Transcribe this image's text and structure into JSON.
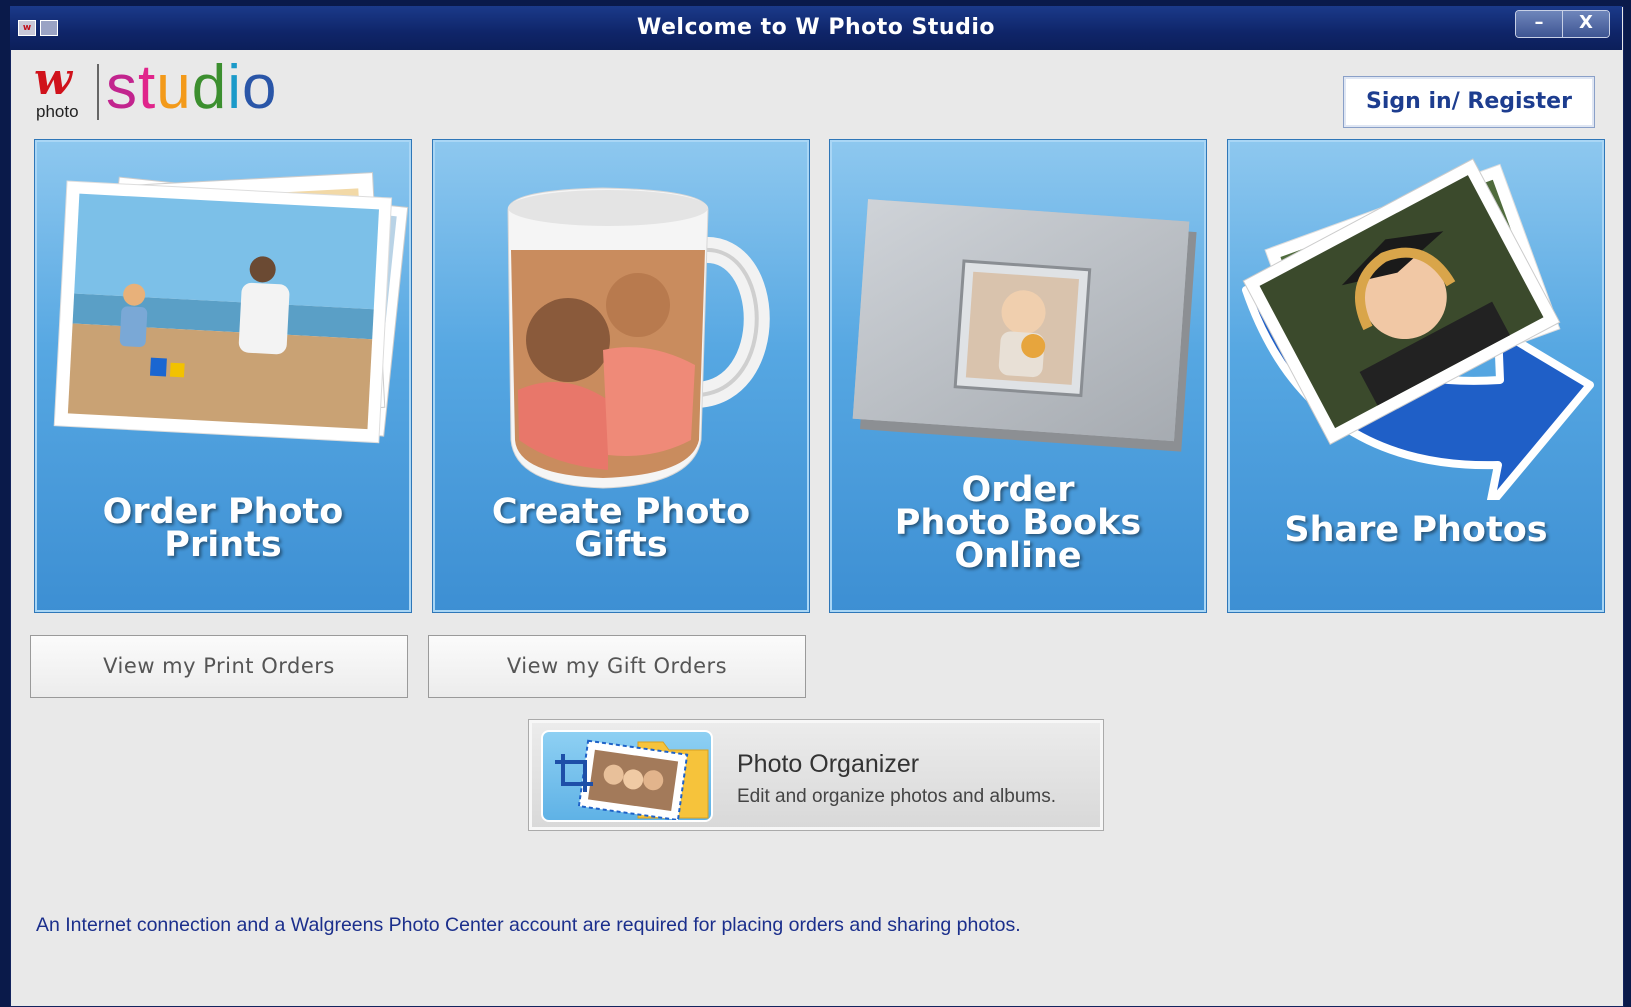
{
  "window": {
    "title": "Welcome to W Photo Studio",
    "minimize_glyph": "–",
    "close_glyph": "X"
  },
  "logo": {
    "w": "w",
    "photo": "photo",
    "studio_letters": [
      "s",
      "t",
      "u",
      "d",
      "i",
      "o"
    ]
  },
  "header": {
    "signin_label": "Sign in/ Register"
  },
  "tiles": [
    {
      "lines": [
        "Order Photo",
        "Prints"
      ]
    },
    {
      "lines": [
        "Create Photo",
        "Gifts"
      ]
    },
    {
      "lines": [
        "Order",
        "Photo Books",
        "Online"
      ]
    },
    {
      "lines": [
        "Share Photos"
      ]
    }
  ],
  "buttons": {
    "view_print_orders": "View my Print Orders",
    "view_gift_orders": "View my Gift Orders"
  },
  "organizer": {
    "title": "Photo Organizer",
    "subtitle": "Edit and organize photos and albums."
  },
  "footer": {
    "notice": "An Internet connection and a Walgreens Photo Center account are required for placing orders and sharing photos."
  },
  "colors": {
    "titlebar": "#0f2569",
    "tile_blue": "#56a7e2",
    "link_blue": "#1b2f8c",
    "brand_red": "#d0121b"
  }
}
